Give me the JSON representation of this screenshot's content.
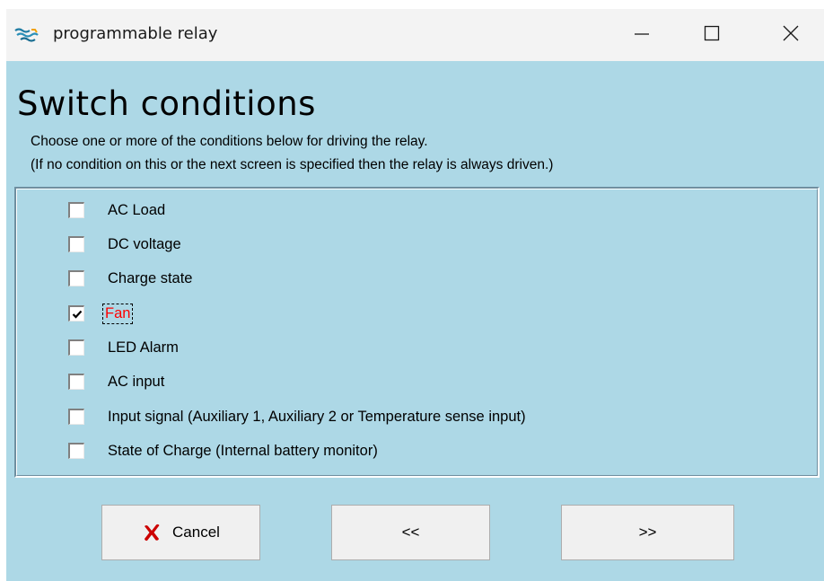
{
  "window": {
    "title": "programmable relay",
    "icon": "victron-app-icon",
    "controls": {
      "minimize": "minimize-icon",
      "maximize": "maximize-icon",
      "close": "close-icon"
    }
  },
  "page": {
    "heading": "Switch conditions",
    "description_line1": "Choose one or more of the conditions below for driving the relay.",
    "description_line2": "(If no condition on this or the next screen is specified then the relay is always driven.)"
  },
  "conditions": [
    {
      "label": "AC Load",
      "checked": false
    },
    {
      "label": "DC voltage",
      "checked": false
    },
    {
      "label": "Charge state",
      "checked": false
    },
    {
      "label": "Fan",
      "checked": true,
      "focused": true
    },
    {
      "label": "LED Alarm",
      "checked": false
    },
    {
      "label": "AC input",
      "checked": false
    },
    {
      "label": "Input signal (Auxiliary 1, Auxiliary 2 or Temperature sense input)",
      "checked": false
    },
    {
      "label": "State of Charge (Internal battery monitor)",
      "checked": false
    }
  ],
  "buttons": {
    "cancel_label": "Cancel",
    "back_label": "<<",
    "next_label": ">>"
  },
  "colors": {
    "background": "#add8e6",
    "focused_label": "#ff0000",
    "cancel_icon": "#cc0000"
  }
}
